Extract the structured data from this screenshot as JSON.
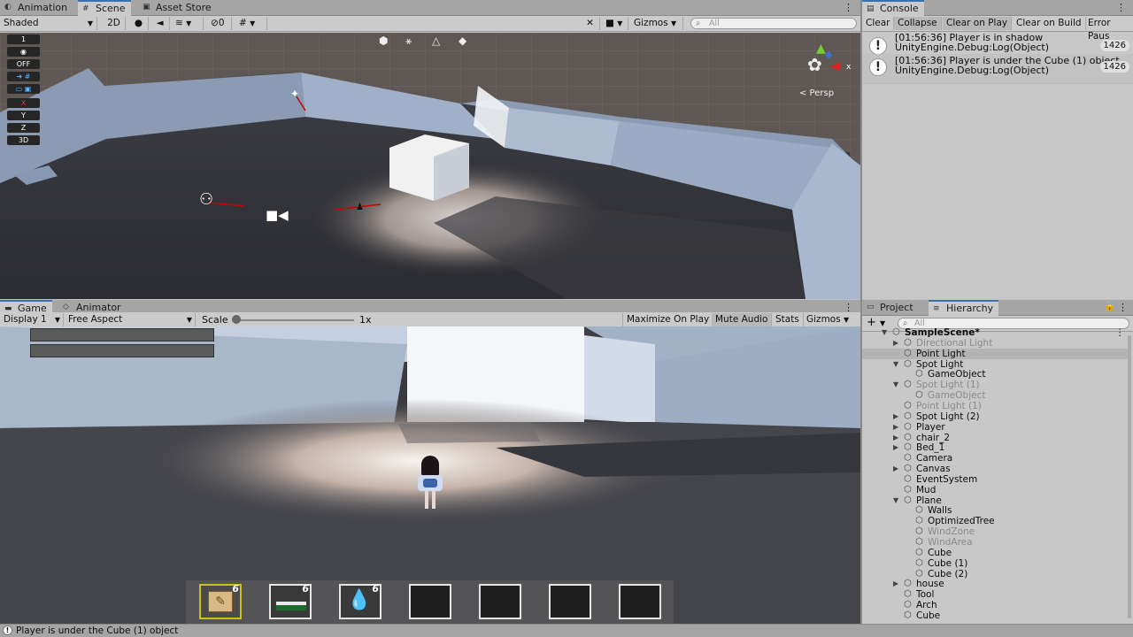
{
  "top_tabs": {
    "animation": "Animation",
    "scene": "Scene",
    "asset_store": "Asset Store"
  },
  "scene_toolbar": {
    "shading": "Shaded",
    "mode_2d": "2D",
    "hidden_count": "0",
    "gizmos": "Gizmos",
    "search_placeholder": "All"
  },
  "scene_overlay": {
    "persp_label": "< Persp",
    "left_tools": [
      "1",
      "",
      "OFF",
      "",
      "",
      "X",
      "Y",
      "Z",
      "3D"
    ]
  },
  "console": {
    "tab": "Console",
    "buttons": [
      "Clear",
      "Collapse",
      "Clear on Play",
      "Clear on Build",
      "Error Paus"
    ],
    "entries": [
      {
        "line1": "[01:56:36] Player is in shadow",
        "line2": "UnityEngine.Debug:Log(Object)",
        "count": "1426"
      },
      {
        "line1": "[01:56:36] Player is under the Cube (1) object",
        "line2": "UnityEngine.Debug:Log(Object)",
        "count": "1426"
      }
    ]
  },
  "game_tabs": {
    "game": "Game",
    "animator": "Animator"
  },
  "game_toolbar": {
    "display": "Display 1",
    "aspect": "Free Aspect",
    "scale_label": "Scale",
    "scale_value": "1x",
    "maximize": "Maximize On Play",
    "mute": "Mute Audio",
    "stats": "Stats",
    "gizmos": "Gizmos"
  },
  "hotbar": {
    "slots": [
      {
        "count": "6",
        "icon": "scroll-icon",
        "selected": true
      },
      {
        "count": "6",
        "icon": "bed-icon"
      },
      {
        "count": "6",
        "icon": "water-drops-icon"
      },
      {
        "count": ""
      },
      {
        "count": ""
      },
      {
        "count": ""
      },
      {
        "count": ""
      }
    ]
  },
  "hierarchy": {
    "project_tab": "Project",
    "hierarchy_tab": "Hierarchy",
    "search_placeholder": "All",
    "items": [
      {
        "label": "SampleScene*",
        "depth": 0,
        "arrow": "open",
        "bold": true
      },
      {
        "label": "Directional Light",
        "depth": 1,
        "arrow": "closed",
        "dim": true
      },
      {
        "label": "Point Light",
        "depth": 1,
        "arrow": "",
        "selected": true
      },
      {
        "label": "Spot Light",
        "depth": 1,
        "arrow": "open"
      },
      {
        "label": "GameObject",
        "depth": 2,
        "arrow": ""
      },
      {
        "label": "Spot Light (1)",
        "depth": 1,
        "arrow": "open",
        "dim": true
      },
      {
        "label": "GameObject",
        "depth": 2,
        "arrow": "",
        "dim": true
      },
      {
        "label": "Point Light (1)",
        "depth": 1,
        "arrow": "",
        "dim": true
      },
      {
        "label": "Spot Light (2)",
        "depth": 1,
        "arrow": "closed"
      },
      {
        "label": "Player",
        "depth": 1,
        "arrow": "closed"
      },
      {
        "label": "chair_2",
        "depth": 1,
        "arrow": "closed"
      },
      {
        "label": "Bed_1",
        "depth": 1,
        "arrow": "closed"
      },
      {
        "label": "Camera",
        "depth": 1,
        "arrow": ""
      },
      {
        "label": "Canvas",
        "depth": 1,
        "arrow": "closed"
      },
      {
        "label": "EventSystem",
        "depth": 1,
        "arrow": ""
      },
      {
        "label": "Mud",
        "depth": 1,
        "arrow": ""
      },
      {
        "label": "Plane",
        "depth": 1,
        "arrow": "open"
      },
      {
        "label": "Walls",
        "depth": 2,
        "arrow": ""
      },
      {
        "label": "OptimizedTree",
        "depth": 2,
        "arrow": ""
      },
      {
        "label": "WindZone",
        "depth": 2,
        "arrow": "",
        "dim": true
      },
      {
        "label": "WindArea",
        "depth": 2,
        "arrow": "",
        "dim": true
      },
      {
        "label": "Cube",
        "depth": 2,
        "arrow": ""
      },
      {
        "label": "Cube (1)",
        "depth": 2,
        "arrow": ""
      },
      {
        "label": "Cube (2)",
        "depth": 2,
        "arrow": ""
      },
      {
        "label": "house",
        "depth": 1,
        "arrow": "closed"
      },
      {
        "label": "Tool",
        "depth": 1,
        "arrow": ""
      },
      {
        "label": "Arch",
        "depth": 1,
        "arrow": ""
      },
      {
        "label": "Cube",
        "depth": 1,
        "arrow": ""
      }
    ]
  },
  "status_bar": {
    "message": "Player is under the Cube (1) object"
  },
  "colors": {
    "accent": "#3a72b0",
    "selected_row": "#b4b4b4",
    "slot_highlight": "#c9c21c"
  }
}
